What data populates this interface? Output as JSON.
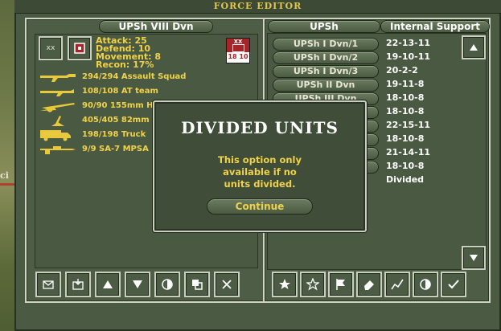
{
  "window": {
    "title": "FORCE EDITOR"
  },
  "map": {
    "text": "ci"
  },
  "left_panel": {
    "unit_name": "UPSh VIII Dvn",
    "stats": [
      "Attack: 25",
      "Defend: 10",
      "Movement: 8",
      "Recon: 17%"
    ],
    "counter": {
      "top": "XX",
      "bottom": "18 10"
    },
    "units": [
      {
        "icon": "rifle-icon",
        "label": "294/294 Assault Squad"
      },
      {
        "icon": "at-rifle-icon",
        "label": "108/108 AT team"
      },
      {
        "icon": "howitzer-icon",
        "label": "90/90 155mm H"
      },
      {
        "icon": "mortar-icon",
        "label": "405/405 82mm"
      },
      {
        "icon": "truck-icon",
        "label": "198/198 Truck"
      },
      {
        "icon": "sam-icon",
        "label": "9/9 SA-7 MPSA"
      }
    ]
  },
  "right_panel": {
    "col_header": "UPSh",
    "col2_header": "Internal Support",
    "items": [
      {
        "name": "UPSh I Dvn/1",
        "value": "22-13-11"
      },
      {
        "name": "UPSh I Dvn/2",
        "value": "19-10-11"
      },
      {
        "name": "UPSh I Dvn/3",
        "value": "20-2-2"
      },
      {
        "name": "UPSh II Dvn",
        "value": "19-11-8"
      },
      {
        "name": "UPSh III Dvn",
        "value": "18-10-8"
      },
      {
        "name": "",
        "value": "18-10-8"
      },
      {
        "name": "",
        "value": "22-15-11"
      },
      {
        "name": "",
        "value": "18-10-8"
      },
      {
        "name": "",
        "value": "21-14-11"
      },
      {
        "name": "",
        "value": "18-10-8"
      },
      {
        "name": "",
        "value": "Divided"
      }
    ]
  },
  "modal": {
    "title": "DIVIDED UNITS",
    "message_lines": [
      "This option only",
      "available if no",
      "units divided."
    ],
    "button": "Continue"
  },
  "colors": {
    "panel": "#4e5e46",
    "accent": "#f0d24a",
    "border": "#c9cfbf"
  }
}
